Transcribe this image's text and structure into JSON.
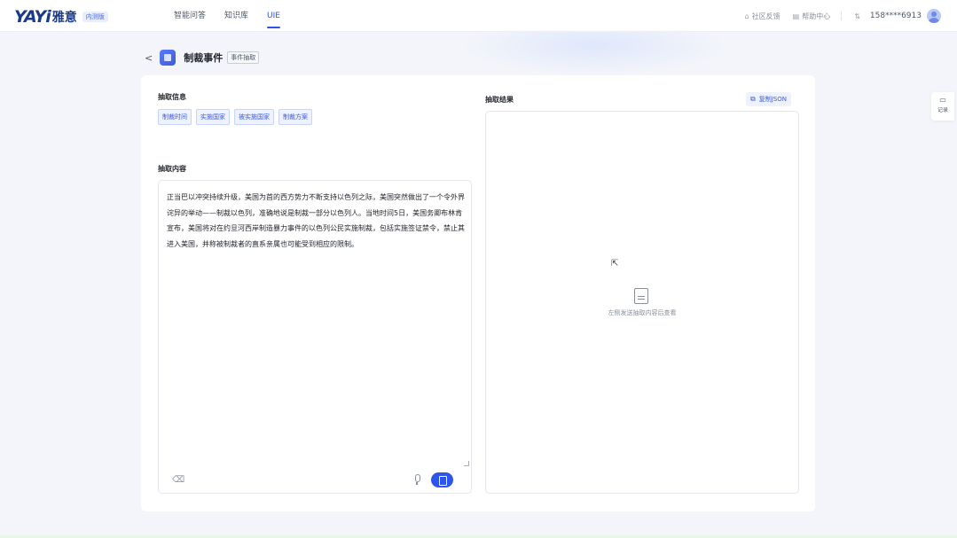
{
  "brand": {
    "logo_mark": "YAYi",
    "logo_cn": "雅意",
    "badge": "内测版"
  },
  "nav": {
    "items": [
      {
        "label": "智能问答",
        "active": false
      },
      {
        "label": "知识库",
        "active": false
      },
      {
        "label": "UIE",
        "active": true
      }
    ]
  },
  "top_right": {
    "feedback": "社区反馈",
    "help": "帮助中心",
    "phone": "158****6913"
  },
  "page": {
    "title": "制裁事件",
    "title_tag": "事件抽取"
  },
  "extract_info": {
    "label": "抽取信息",
    "tags": [
      "制裁时间",
      "实施国家",
      "被实施国家",
      "制裁方案"
    ]
  },
  "extract_content": {
    "label": "抽取内容",
    "text": "正当巴以冲突持续升级，美国为首的西方势力不断支持以色列之际，美国突然做出了一个令外界诧异的举动——制裁以色列，准确地说是制裁一部分以色列人。当地时间5日，美国务卿布林肯宣布，美国将对在约旦河西岸制造暴力事件的以色列公民实施制裁，包括实施签证禁令，禁止其进入美国，并称被制裁者的直系亲属也可能受到相应的限制。"
  },
  "result": {
    "label": "抽取结果",
    "copy_label": "复制JSON",
    "empty_text": "左侧发送抽取内容后查看"
  },
  "side_float": {
    "label": "记录"
  },
  "colors": {
    "accent": "#2f54eb",
    "brand": "#1b3a8a"
  }
}
